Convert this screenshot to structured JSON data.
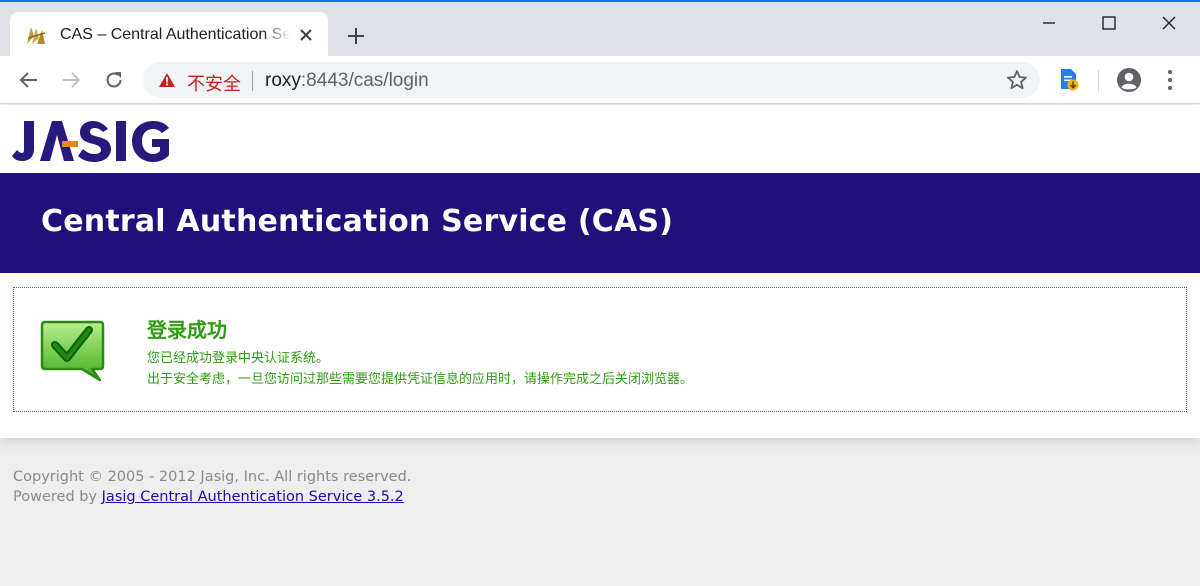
{
  "browser": {
    "tab_title": "CAS – Central Authentication Service",
    "security_label": "不安全",
    "url_host": "roxy",
    "url_rest": ":8443/cas/login"
  },
  "page": {
    "logo_text": "JA-SIG",
    "banner_title": "Central Authentication Service (CAS)",
    "message": {
      "title": "登录成功",
      "line1": "您已经成功登录中央认证系统。",
      "line2": "出于安全考虑，一旦您访问过那些需要您提供凭证信息的应用时，请操作完成之后关闭浏览器。"
    },
    "footer": {
      "copyright": "Copyright © 2005 - 2012 Jasig, Inc. All rights reserved.",
      "powered_prefix": "Powered by",
      "powered_link": "Jasig Central Authentication Service 3.5.2"
    }
  },
  "colors": {
    "banner": "#210f7a",
    "success": "#2f9c12",
    "not_secure": "#c5221f",
    "link": "#1a0dab"
  }
}
